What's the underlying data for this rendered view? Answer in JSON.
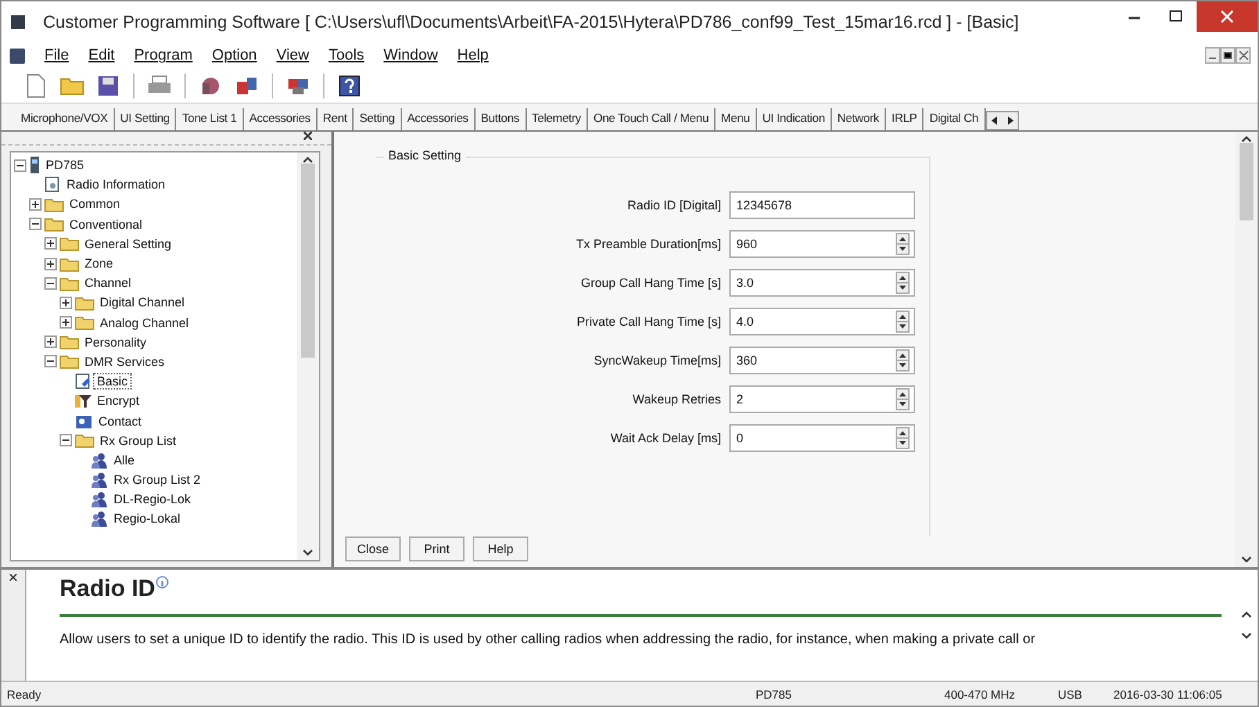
{
  "window": {
    "title": "Customer Programming Software [ C:\\Users\\ufl\\Documents\\Arbeit\\FA-2015\\Hytera\\PD786_conf99_Test_15mar16.rcd ] - [Basic]"
  },
  "menu": [
    "File",
    "Edit",
    "Program",
    "Option",
    "View",
    "Tools",
    "Window",
    "Help"
  ],
  "tabs": [
    "Microphone/VOX",
    "UI Setting",
    "Tone List 1",
    "Accessories",
    "Rent",
    "Setting",
    "Accessories",
    "Buttons",
    "Telemetry",
    "One Touch Call / Menu",
    "Menu",
    "UI Indication",
    "Network",
    "IRLP",
    "Digital Ch"
  ],
  "tree": [
    {
      "label": "PD785",
      "kind": "device",
      "expanded": true,
      "selected": false,
      "children": [
        {
          "label": "Radio Information",
          "kind": "info",
          "selected": false
        },
        {
          "label": "Common",
          "kind": "folder",
          "expanded": false,
          "selected": false
        },
        {
          "label": "Conventional",
          "kind": "folder",
          "expanded": true,
          "selected": false,
          "children": [
            {
              "label": "General Setting",
              "kind": "folder",
              "expanded": false,
              "selected": false
            },
            {
              "label": "Zone",
              "kind": "folder",
              "expanded": false,
              "selected": false
            },
            {
              "label": "Channel",
              "kind": "folder",
              "expanded": true,
              "selected": false,
              "children": [
                {
                  "label": "Digital Channel",
                  "kind": "folder",
                  "expanded": false,
                  "selected": false
                },
                {
                  "label": "Analog Channel",
                  "kind": "folder",
                  "expanded": false,
                  "selected": false
                }
              ]
            },
            {
              "label": "Personality",
              "kind": "folder",
              "expanded": false,
              "selected": false
            },
            {
              "label": "DMR Services",
              "kind": "folder",
              "expanded": true,
              "selected": false,
              "children": [
                {
                  "label": "Basic",
                  "kind": "basic",
                  "selected": true
                },
                {
                  "label": "Encrypt",
                  "kind": "encrypt",
                  "selected": false
                },
                {
                  "label": "Contact",
                  "kind": "contact",
                  "selected": false
                },
                {
                  "label": "Rx Group List",
                  "kind": "folder",
                  "expanded": true,
                  "selected": false,
                  "children": [
                    {
                      "label": "Alle",
                      "kind": "group",
                      "selected": false
                    },
                    {
                      "label": "Rx Group List 2",
                      "kind": "group",
                      "selected": false
                    },
                    {
                      "label": "DL-Regio-Lok",
                      "kind": "group",
                      "selected": false
                    },
                    {
                      "label": "Regio-Lokal",
                      "kind": "group",
                      "selected": false
                    }
                  ]
                }
              ]
            }
          ]
        }
      ]
    }
  ],
  "form": {
    "title": "Basic Setting",
    "fields": [
      {
        "label": "Radio ID [Digital]",
        "value": "12345678",
        "kind": "text"
      },
      {
        "label": "Tx Preamble Duration[ms]",
        "value": "960",
        "kind": "spin"
      },
      {
        "label": "Group Call Hang Time [s]",
        "value": "3.0",
        "kind": "spin"
      },
      {
        "label": "Private Call Hang Time [s]",
        "value": "4.0",
        "kind": "spin"
      },
      {
        "label": "SyncWakeup Time[ms]",
        "value": "360",
        "kind": "spin"
      },
      {
        "label": "Wakeup Retries",
        "value": "2",
        "kind": "spin"
      },
      {
        "label": "Wait Ack Delay [ms]",
        "value": "0",
        "kind": "spin"
      }
    ],
    "buttons": [
      "Close",
      "Print",
      "Help"
    ]
  },
  "help": {
    "title": "Radio ID",
    "text": "Allow users to set a unique ID to identify the radio. This ID is used by other calling radios when addressing the radio, for instance, when making a private call or"
  },
  "status_bar": [
    "Ready",
    "PD785",
    "400-470 MHz",
    "USB",
    "2016-03-30 11:06:05"
  ]
}
